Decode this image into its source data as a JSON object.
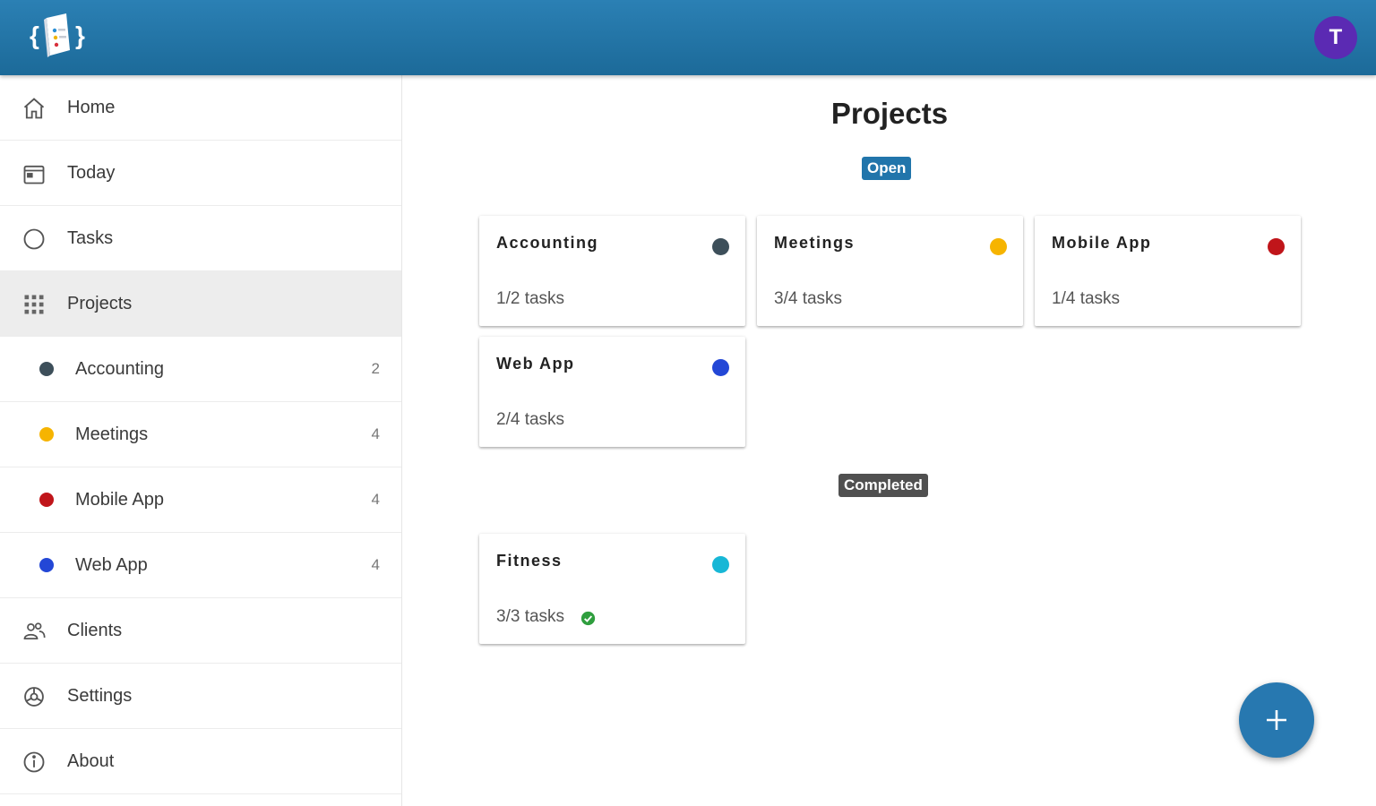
{
  "header": {
    "avatar_letter": "T",
    "avatar_color": "#5b2ab3"
  },
  "sidebar": {
    "items": [
      {
        "label": "Home",
        "icon": "home-icon"
      },
      {
        "label": "Today",
        "icon": "calendar-icon"
      },
      {
        "label": "Tasks",
        "icon": "circle-icon"
      },
      {
        "label": "Projects",
        "icon": "grid-icon",
        "selected": true
      }
    ],
    "projects": [
      {
        "label": "Accounting",
        "count": "2",
        "color": "#3d4f5a"
      },
      {
        "label": "Meetings",
        "count": "4",
        "color": "#f6b400"
      },
      {
        "label": "Mobile App",
        "count": "4",
        "color": "#c0151a"
      },
      {
        "label": "Web App",
        "count": "4",
        "color": "#2347d6"
      }
    ],
    "bottom_items": [
      {
        "label": "Clients",
        "icon": "people-icon"
      },
      {
        "label": "Settings",
        "icon": "settings-icon"
      },
      {
        "label": "About",
        "icon": "info-icon"
      }
    ]
  },
  "main": {
    "title": "Projects",
    "open_label": "Open",
    "open_color": "#2175ab",
    "completed_label": "Completed",
    "completed_color": "#505050",
    "open_projects": [
      {
        "name": "Accounting",
        "tasks": "1/2 tasks",
        "color": "#3d4f5a"
      },
      {
        "name": "Meetings",
        "tasks": "3/4 tasks",
        "color": "#f6b400"
      },
      {
        "name": "Mobile App",
        "tasks": "1/4 tasks",
        "color": "#c0151a"
      },
      {
        "name": "Web App",
        "tasks": "2/4 tasks",
        "color": "#2347d6"
      }
    ],
    "completed_projects": [
      {
        "name": "Fitness",
        "tasks": "3/3 tasks",
        "color": "#17b7d6",
        "done": true
      }
    ]
  },
  "fab": {
    "icon": "plus-icon"
  },
  "colors": {
    "check_green": "#2f9e3e"
  }
}
